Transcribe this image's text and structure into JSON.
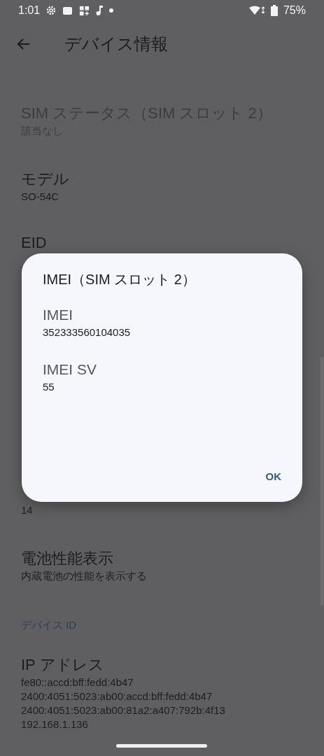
{
  "status_bar": {
    "time": "1:01",
    "battery": "75%"
  },
  "app_bar": {
    "title": "デバイス情報"
  },
  "list": [
    {
      "kind": "item",
      "title": "SIM ステータス（SIM スロット 2）",
      "summary": "該当なし",
      "disabled": true
    },
    {
      "kind": "item",
      "title": "モデル",
      "summary": "SO-54C",
      "disabled": false
    },
    {
      "kind": "title_only",
      "title": "EID",
      "disabled": false
    },
    {
      "kind": "summary_only",
      "summary": "14",
      "disabled": false
    },
    {
      "kind": "item",
      "title": "電池性能表示",
      "summary": "内蔵電池の性能を表示する",
      "disabled": false
    },
    {
      "kind": "header",
      "title": "デバイス ID"
    },
    {
      "kind": "item",
      "title": "IP アドレス",
      "summary": "fe80::accd:bff:fedd:4b47\n2400:4051:5023:ab00:accd:bff:fedd:4b47\n2400:4051:5023:ab00:81a2:a407:792b:4f13\n192.168.1.136",
      "disabled": false
    }
  ],
  "dialog": {
    "title": "IMEI（SIM スロット 2）",
    "fields": [
      {
        "label": "IMEI",
        "value": "352333560104035"
      },
      {
        "label": "IMEI SV",
        "value": "55"
      }
    ],
    "button": "OK"
  }
}
